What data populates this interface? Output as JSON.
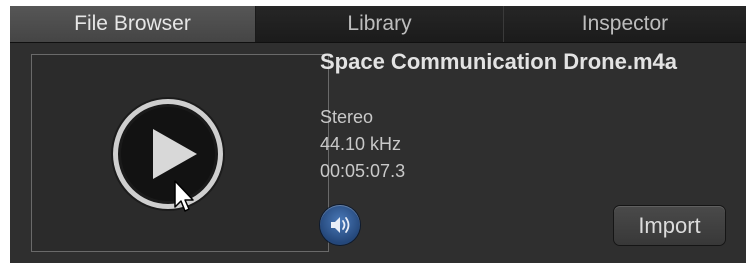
{
  "tabs": [
    {
      "label": "File Browser",
      "active": true
    },
    {
      "label": "Library",
      "active": false
    },
    {
      "label": "Inspector",
      "active": false
    }
  ],
  "file": {
    "name": "Space Communication Drone.m4a",
    "channels": "Stereo",
    "sample_rate": "44.10 kHz",
    "duration": "00:05:07.3"
  },
  "preview": {
    "play_icon": "play-icon",
    "cursor_icon": "arrow-pointer-icon"
  },
  "controls": {
    "volume_icon": "speaker-icon",
    "import_label": "Import"
  },
  "colors": {
    "panel_bg": "#2f2f2f",
    "tab_active_bg": "#4d4d4d",
    "volume_button": "#3a66a6",
    "text_primary": "#e3e3e3"
  }
}
